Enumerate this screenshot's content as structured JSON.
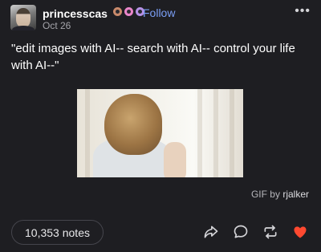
{
  "post": {
    "username": "princesscas",
    "follow_label": "Follow",
    "date": "Oct 26",
    "more_label": "•••",
    "text": "\"edit images with AI-- search with AI-- control your life with AI--\"",
    "gif_credit_prefix": "GIF by",
    "gif_credit_user": "rjalker",
    "notes_label": "10,353 notes"
  },
  "badges": [
    {
      "name": "badge-1",
      "color": "#c98a6b"
    },
    {
      "name": "badge-2",
      "color": "#e985c9"
    },
    {
      "name": "badge-3",
      "color": "#b691e6"
    }
  ],
  "colors": {
    "background": "#1e1e22",
    "follow": "#7b9ff6",
    "like": "#ff4930",
    "icon": "#d4d4d8"
  },
  "icons": [
    "share-icon",
    "reply-icon",
    "reblog-icon",
    "like-icon"
  ]
}
